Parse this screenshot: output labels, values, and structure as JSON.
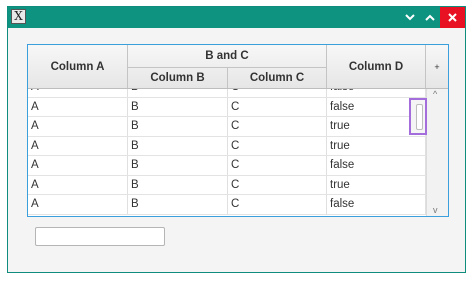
{
  "titlebar": {
    "app_icon_glyph": "X",
    "buttons": [
      "minimize",
      "maximize",
      "close"
    ],
    "colors": {
      "bar": "#0e9381",
      "close": "#e81123"
    }
  },
  "table": {
    "headers": {
      "col_a": "Column A",
      "group_bc": "B and C",
      "col_b": "Column B",
      "col_c": "Column C",
      "col_d": "Column D",
      "menu_glyph": "+"
    },
    "rows": [
      [
        "A",
        "B",
        "C",
        "false"
      ],
      [
        "A",
        "B",
        "C",
        "false"
      ],
      [
        "A",
        "B",
        "C",
        "true"
      ],
      [
        "A",
        "B",
        "C",
        "true"
      ],
      [
        "A",
        "B",
        "C",
        "false"
      ],
      [
        "A",
        "B",
        "C",
        "true"
      ],
      [
        "A",
        "B",
        "C",
        "false"
      ]
    ],
    "scroll": {
      "up_glyph": "^",
      "down_glyph": "v",
      "highlight_color": "#a36ddb"
    }
  },
  "text_field": {
    "value": "",
    "placeholder": ""
  }
}
